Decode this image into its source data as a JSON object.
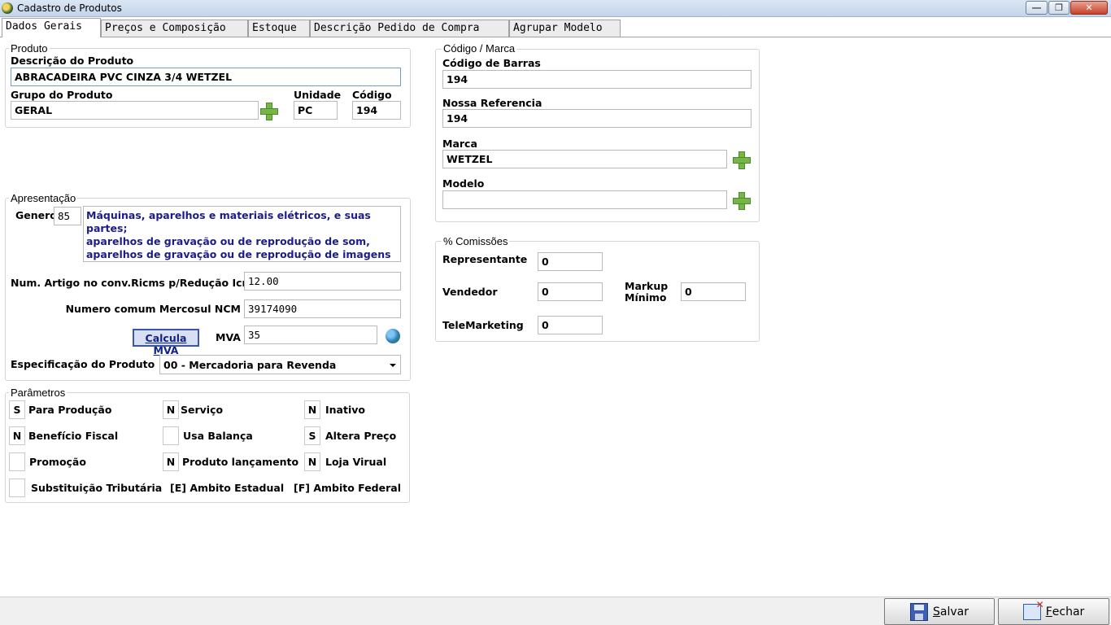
{
  "window": {
    "title": "Cadastro de Produtos",
    "minimize_glyph": "—",
    "maximize_glyph": "❐",
    "close_glyph": "✕"
  },
  "tabs": [
    {
      "label": "Dados Gerais"
    },
    {
      "label": "Preços e Composição"
    },
    {
      "label": "Estoque"
    },
    {
      "label": "Descrição Pedido de Compra"
    },
    {
      "label": "Agrupar Modelo"
    }
  ],
  "produto": {
    "group_title": "Produto",
    "descricao_label": "Descrição do Produto",
    "descricao_value": "ABRACADEIRA PVC CINZA 3/4 WETZEL",
    "grupo_label": "Grupo do Produto",
    "grupo_value": "GERAL",
    "unidade_label": "Unidade",
    "unidade_value": "PC",
    "codigo_label": "Código",
    "codigo_value": "194"
  },
  "codigo_marca": {
    "group_title": "Código / Marca",
    "barras_label": "Código de Barras",
    "barras_value": "194",
    "referencia_label": "Nossa Referencia",
    "referencia_value": "194",
    "marca_label": "Marca",
    "marca_value": "WETZEL",
    "modelo_label": "Modelo",
    "modelo_value": ""
  },
  "apresentacao": {
    "group_title": "Apresentação",
    "genero_label": "Genero",
    "genero_code": "85",
    "genero_desc_lines": [
      "Máquinas, aparelhos e materiais elétricos, e suas partes;",
      "aparelhos de gravação ou de reprodução de som,",
      "aparelhos de gravação ou de reprodução de imagens e de"
    ],
    "num_artigo_label": "Num. Artigo no conv.Ricms p/Redução Icms",
    "num_artigo_value": "12.00",
    "ncm_label": "Numero comum Mercosul NCM",
    "ncm_value": "39174090",
    "calcula_mva_label": "Calcula MVA",
    "mva_label": "MVA",
    "mva_value": "35",
    "especificacao_label": "Especificação do Produto",
    "especificacao_value": "00 - Mercadoria para Revenda"
  },
  "comissoes": {
    "group_title": "% Comissões",
    "representante_label": "Representante",
    "representante_value": "0",
    "vendedor_label": "Vendedor",
    "vendedor_value": "0",
    "markup_label_1": "Markup",
    "markup_label_2": "Mínimo",
    "markup_value": "0",
    "telemarketing_label": "TeleMarketing",
    "telemarketing_value": "0"
  },
  "parametros": {
    "group_title": "Parâmetros",
    "para_producao": {
      "flag": "S",
      "label": "Para Produção"
    },
    "servico": {
      "flag": "N",
      "label": "Serviço"
    },
    "inativo": {
      "flag": "N",
      "label": "Inativo"
    },
    "beneficio_fiscal": {
      "flag": "N",
      "label": "Benefício Fiscal"
    },
    "usa_balanca": {
      "flag": "",
      "label": "Usa Balança"
    },
    "altera_preco": {
      "flag": "S",
      "label": "Altera Preço"
    },
    "promocao": {
      "flag": "",
      "label": "Promoção"
    },
    "produto_lancamento": {
      "flag": "N",
      "label": "Produto lançamento"
    },
    "loja_virtual": {
      "flag": "N",
      "label": "Loja Virual"
    },
    "substituicao": {
      "flag": "",
      "label": "Substituição Tributária"
    },
    "ambito_estadual": "[E] Ambito Estadual",
    "ambito_federal": "[F] Ambito Federal"
  },
  "footer": {
    "salvar_first": "S",
    "salvar_rest": "alvar",
    "fechar_first": "F",
    "fechar_rest": "echar"
  }
}
